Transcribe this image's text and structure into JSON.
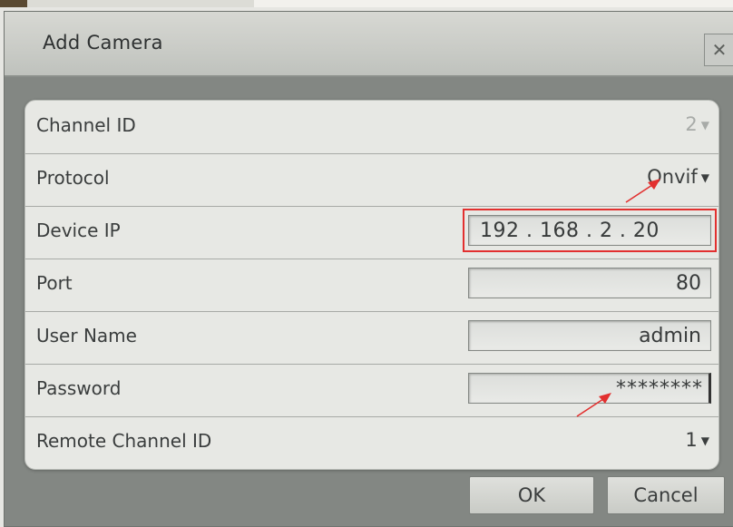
{
  "dialog": {
    "title": "Add Camera",
    "close_icon": "close-icon"
  },
  "fields": {
    "channel_id": {
      "label": "Channel ID",
      "value": "2"
    },
    "protocol": {
      "label": "Protocol",
      "value": "Onvif"
    },
    "device_ip": {
      "label": "Device IP",
      "value": "192 . 168 .  2   . 20"
    },
    "port": {
      "label": "Port",
      "value": "80"
    },
    "user_name": {
      "label": "User Name",
      "value": "admin"
    },
    "password": {
      "label": "Password",
      "value": "********"
    },
    "remote_channel_id": {
      "label": "Remote Channel ID",
      "value": "1"
    }
  },
  "buttons": {
    "ok": "OK",
    "cancel": "Cancel"
  },
  "annotations": {
    "highlight_color": "#e2302f",
    "arrow_icon": "red-arrow-icon"
  },
  "icons": {
    "caret": "▼"
  }
}
